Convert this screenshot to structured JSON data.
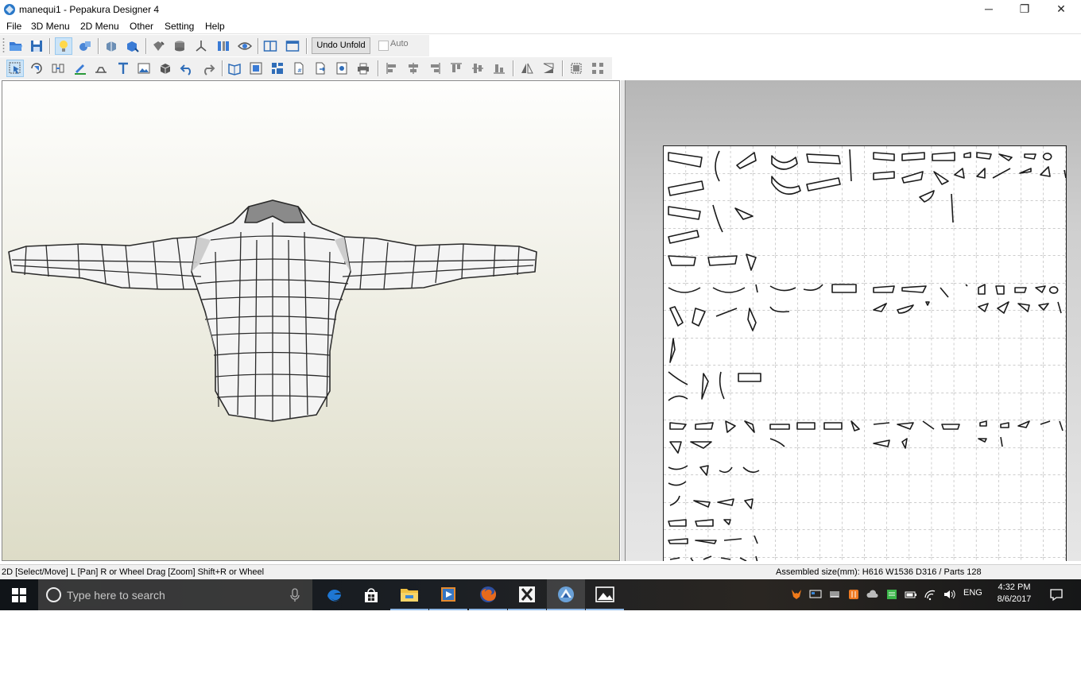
{
  "window": {
    "title": "manequi1 - Pepakura Designer 4",
    "minimize_glyph": "─",
    "maximize_glyph": "❐",
    "close_glyph": "✕"
  },
  "menu": {
    "items": [
      "File",
      "3D Menu",
      "2D Menu",
      "Other",
      "Setting",
      "Help"
    ]
  },
  "toolbar": {
    "undo_unfold_label": "Undo Unfold",
    "auto_label": "Auto",
    "auto_checked": false
  },
  "status": {
    "left_text": "2D [Select/Move] L [Pan] R or Wheel Drag [Zoom] Shift+R or Wheel",
    "right_text": "Assembled size(mm): H616 W1536 D316 / Parts 128"
  },
  "taskbar": {
    "search_placeholder": "Type here to search",
    "language": "ENG",
    "time": "4:32 PM",
    "date": "8/6/2017",
    "apps": [
      "edge-icon",
      "store-icon",
      "file-explorer-icon",
      "media-player-icon",
      "firefox-icon",
      "xmind-icon",
      "pepakura-icon",
      "photos-icon"
    ]
  },
  "colors": {
    "taskbar_accent": "#8fb8e6",
    "edge_blue": "#1e77d4",
    "folder_yellow": "#f0c040"
  }
}
